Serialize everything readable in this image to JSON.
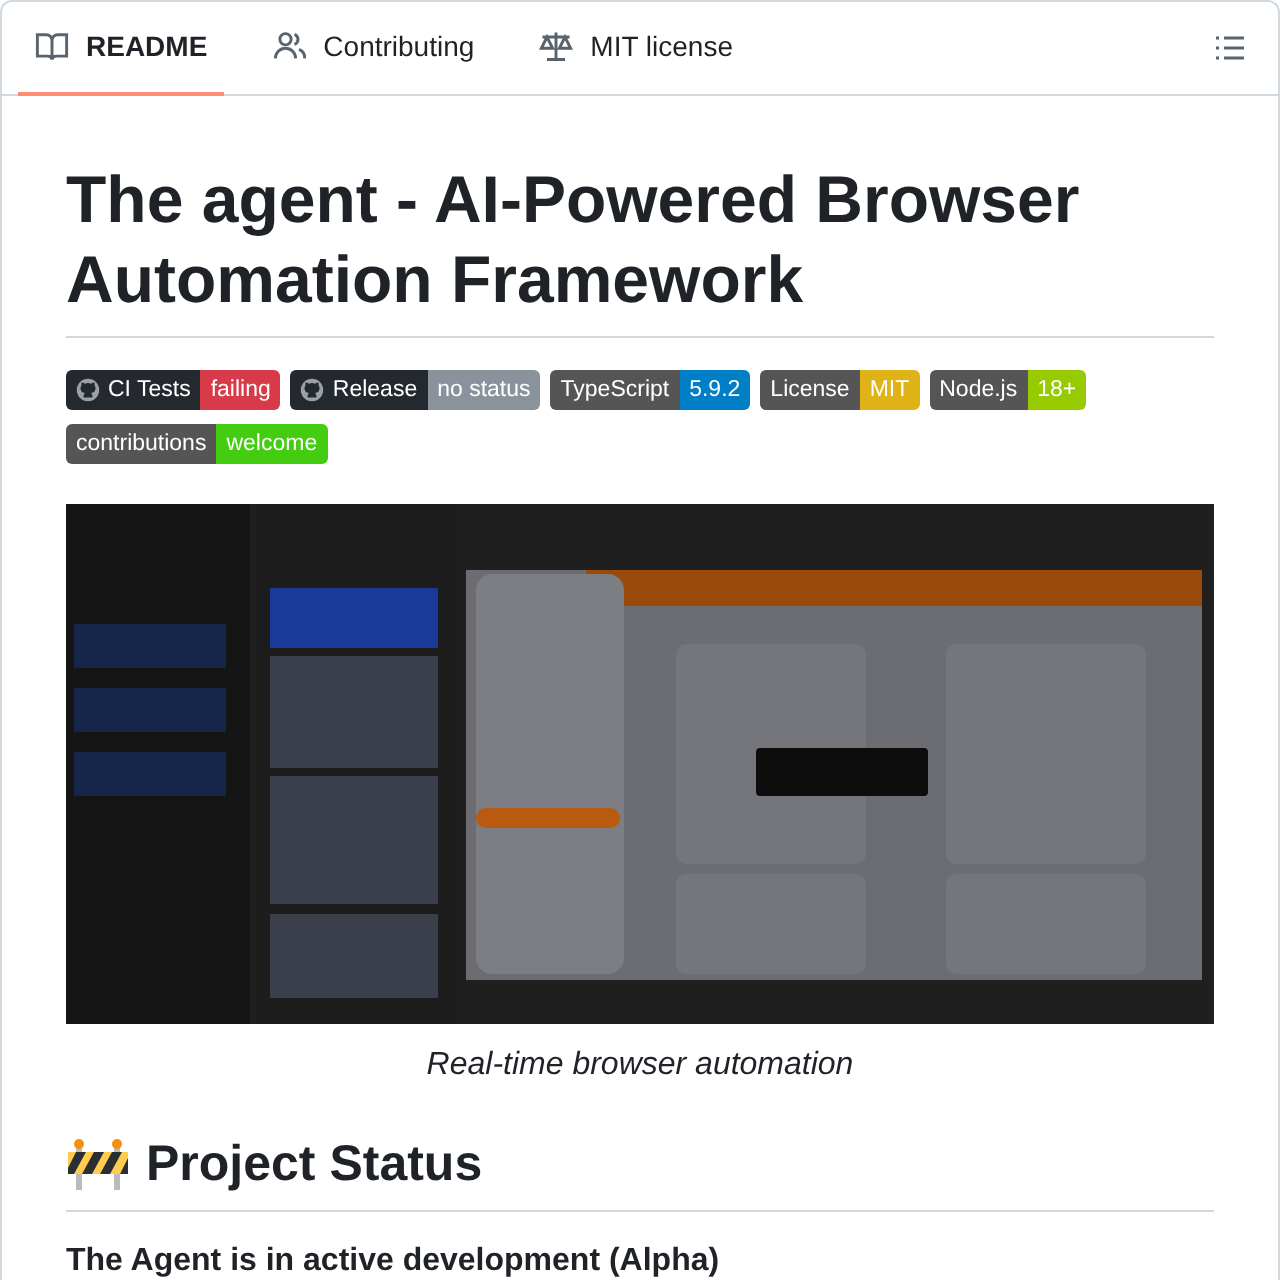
{
  "tabs": [
    {
      "label": "README",
      "kind": "book",
      "selected": true
    },
    {
      "label": "Contributing",
      "kind": "people",
      "selected": false
    },
    {
      "label": "MIT license",
      "kind": "scale",
      "selected": false
    }
  ],
  "title": "The agent - AI-Powered Browser Automation Framework",
  "badges": [
    {
      "label": "CI Tests",
      "message": "failing",
      "color": "#d73a49",
      "logo": true
    },
    {
      "label": "Release",
      "message": "no status",
      "color": "#8a939c",
      "logo": true
    },
    {
      "label": "TypeScript",
      "message": "5.9.2",
      "color": "#007ec6",
      "logo": false
    },
    {
      "label": "License",
      "message": "MIT",
      "color": "#dfb317",
      "logo": false
    },
    {
      "label": "Node.js",
      "message": "18+",
      "color": "#97ca00",
      "logo": false
    },
    {
      "label": "contributions",
      "message": "welcome",
      "color": "#44cc11",
      "logo": false
    }
  ],
  "figure": {
    "kind": "picture",
    "caption": "Real-time browser automation"
  },
  "section": {
    "heading": "Project Status",
    "text": "The Agent is in active development (Alpha)"
  }
}
